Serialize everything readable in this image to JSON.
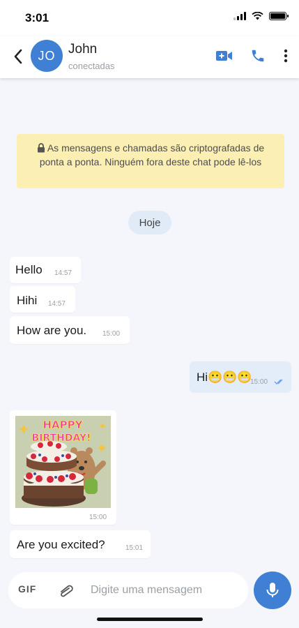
{
  "status_bar": {
    "time": "3:01"
  },
  "header": {
    "avatar_initials": "JO",
    "contact_name": "John",
    "contact_status": "conectadas",
    "accent_color": "#3f7fd4"
  },
  "encryption_notice": "As mensagens e chamadas são criptografadas de ponta a ponta. Ninguém fora deste chat pode lê-los",
  "date_chip": "Hoje",
  "messages": [
    {
      "direction": "incoming",
      "text": "Hello",
      "time": "14:57"
    },
    {
      "direction": "incoming",
      "text": "Hihi",
      "time": "14:57"
    },
    {
      "direction": "incoming",
      "text": "How are you.",
      "time": "15:00"
    },
    {
      "direction": "outgoing",
      "text": "Hi😬😬😬",
      "time": "15:00",
      "status": "read"
    },
    {
      "direction": "incoming",
      "type": "sticker",
      "sticker_text": [
        "HAPPY",
        "BIRTHDAY!"
      ],
      "time": "15:00"
    },
    {
      "direction": "incoming",
      "text": "Are you excited?",
      "time": "15:01"
    }
  ],
  "composer": {
    "gif_label": "GIF",
    "placeholder": "Digite uma mensagem"
  }
}
